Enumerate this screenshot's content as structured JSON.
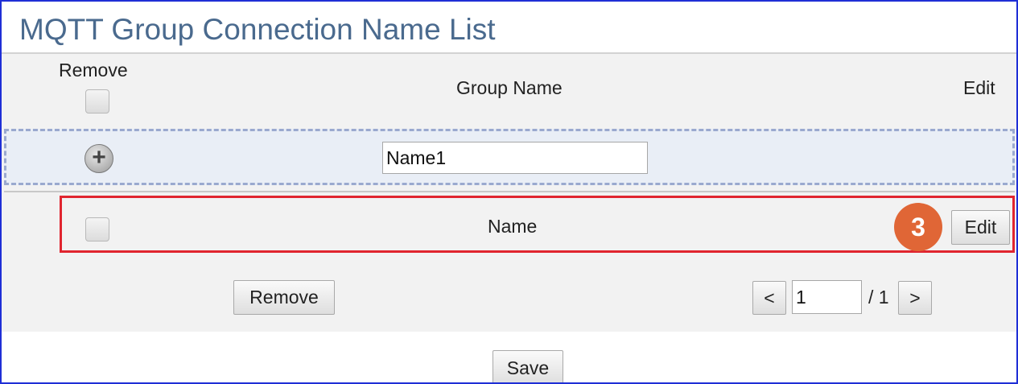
{
  "title": "MQTT Group Connection Name List",
  "header": {
    "remove_label": "Remove",
    "group_name_label": "Group Name",
    "edit_label": "Edit"
  },
  "add_row": {
    "name_value": "Name1"
  },
  "rows": [
    {
      "group_name": "Name",
      "edit_label": "Edit"
    }
  ],
  "annotation": {
    "step": "3",
    "color": "#e06636"
  },
  "actions": {
    "remove_label": "Remove",
    "save_label": "Save"
  },
  "pagination": {
    "prev_label": "<",
    "next_label": ">",
    "current_page": "1",
    "total_label": "/ 1"
  },
  "colors": {
    "title": "#4a6a8e",
    "highlight": "#e0252f",
    "frame": "#1f2fd6"
  }
}
